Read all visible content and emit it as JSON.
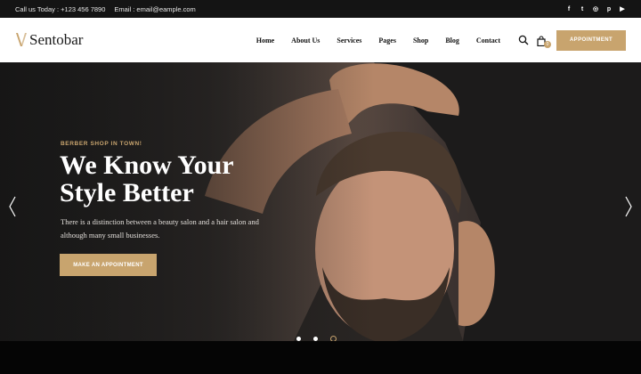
{
  "topbar": {
    "phone": "Call us Today : +123 456 7890",
    "email": "Email : email@eample.com",
    "social": [
      "f",
      "t",
      "◎",
      "p",
      "▶"
    ]
  },
  "header": {
    "logo_text": "Sentobar",
    "nav": [
      "Home",
      "About Us",
      "Services",
      "Pages",
      "Shop",
      "Blog",
      "Contact"
    ],
    "cart_count": "0",
    "appointment_label": "APPOINTMENT"
  },
  "hero": {
    "kicker": "BERBER SHOP IN TOWN!",
    "headline": "We Know Your Style Better",
    "description": "There is a distinction between a beauty salon and a hair salon and although many small businesses.",
    "button_label": "MAKE AN APPOINTMENT",
    "slide_count": 3,
    "active_slide": 3
  },
  "colors": {
    "accent": "#c8a46e",
    "topbar_bg": "#141414"
  }
}
